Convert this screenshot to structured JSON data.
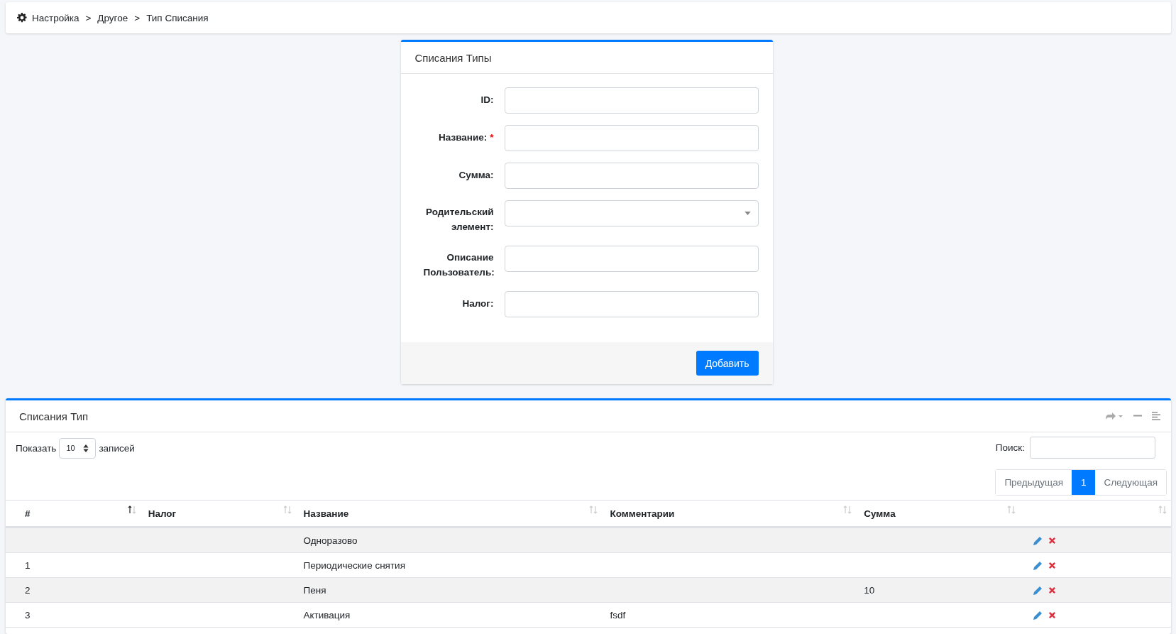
{
  "breadcrumb": {
    "separator": ">",
    "items": [
      "Настройка",
      "Другое",
      "Тип Списания"
    ]
  },
  "form": {
    "title": "Списания Типы",
    "fields": [
      {
        "label": "ID:",
        "kind": "text"
      },
      {
        "label": "Название:",
        "kind": "text",
        "required_mark": "*"
      },
      {
        "label": "Сумма:",
        "kind": "text"
      },
      {
        "label": "Родительский элемент:",
        "kind": "select"
      },
      {
        "label": "Описание Пользователь:",
        "kind": "text"
      },
      {
        "label": "Налог:",
        "kind": "text"
      }
    ],
    "submit": "Добавить"
  },
  "table_card": {
    "title": "Списания Тип",
    "length": {
      "before": "Показать",
      "value": "10",
      "after": "записей"
    },
    "search": {
      "label": "Поиск:"
    },
    "pagination": [
      {
        "label": "Предыдущая",
        "selected": false
      },
      {
        "label": "1",
        "selected": true
      },
      {
        "label": "Следующая",
        "selected": false
      }
    ],
    "columns": [
      {
        "label": "#",
        "sorted_ascending": true
      },
      {
        "label": "Налог",
        "sorted_ascending": false
      },
      {
        "label": "Название",
        "sorted_ascending": false
      },
      {
        "label": "Комментарии",
        "sorted_ascending": false
      },
      {
        "label": "Сумма",
        "sorted_ascending": false
      },
      {
        "sorted_ascending": false
      }
    ],
    "rows": [
      {
        "number": "",
        "tax": "",
        "name": "Одноразово",
        "comment": "",
        "sum": ""
      },
      {
        "number": "1",
        "tax": "",
        "name": "Периодические снятия",
        "comment": "",
        "sum": ""
      },
      {
        "number": "2",
        "tax": "",
        "name": "Пеня",
        "comment": "",
        "sum": "10"
      },
      {
        "number": "3",
        "tax": "",
        "name": "Активация",
        "comment": "fsdf",
        "sum": ""
      }
    ]
  }
}
